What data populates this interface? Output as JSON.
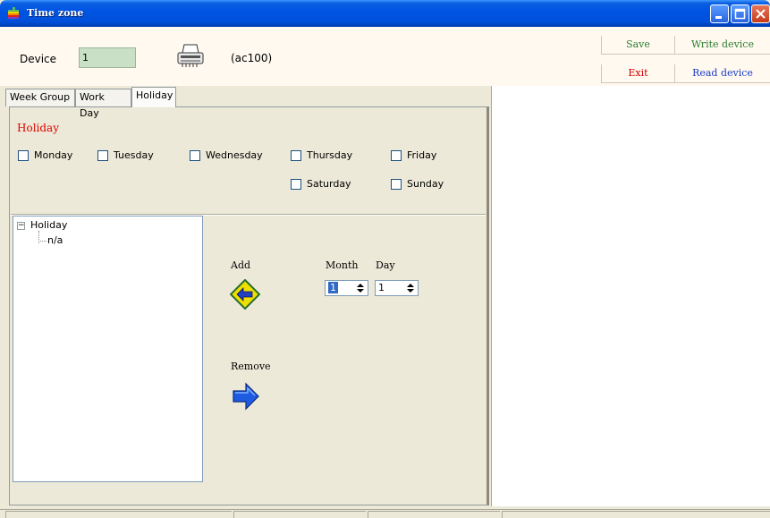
{
  "window": {
    "title": "Time zone"
  },
  "header": {
    "device_label": "Device",
    "device_value": "1",
    "model": "(ac100)",
    "buttons": {
      "save": "Save",
      "write_device": "Write device",
      "exit": "Exit",
      "read_device": "Read device"
    }
  },
  "tabs": [
    {
      "label": "Week Group"
    },
    {
      "label": "Work Day"
    },
    {
      "label": "Holiday",
      "active": true
    }
  ],
  "holiday": {
    "title": "Holiday",
    "days": [
      "Monday",
      "Tuesday",
      "Wednesday",
      "Thursday",
      "Friday",
      "Saturday",
      "Sunday"
    ]
  },
  "tree": {
    "root": "Holiday",
    "children": [
      "n/a"
    ]
  },
  "editor": {
    "add_label": "Add",
    "remove_label": "Remove",
    "month_label": "Month",
    "day_label": "Day",
    "month_value": "1",
    "day_value": "1"
  },
  "colors": {
    "titlebar": "#0054E3",
    "holiday_title": "#E00000",
    "save_write": "#2E7D2E",
    "exit": "#D00000",
    "read": "#1A3CC8",
    "device_field": "#C9DFC6"
  },
  "icons": {
    "app": "rainbow-apple-icon",
    "device": "device-reader-icon",
    "add": "yellow-left-arrow-icon",
    "remove": "blue-right-arrow-icon"
  }
}
